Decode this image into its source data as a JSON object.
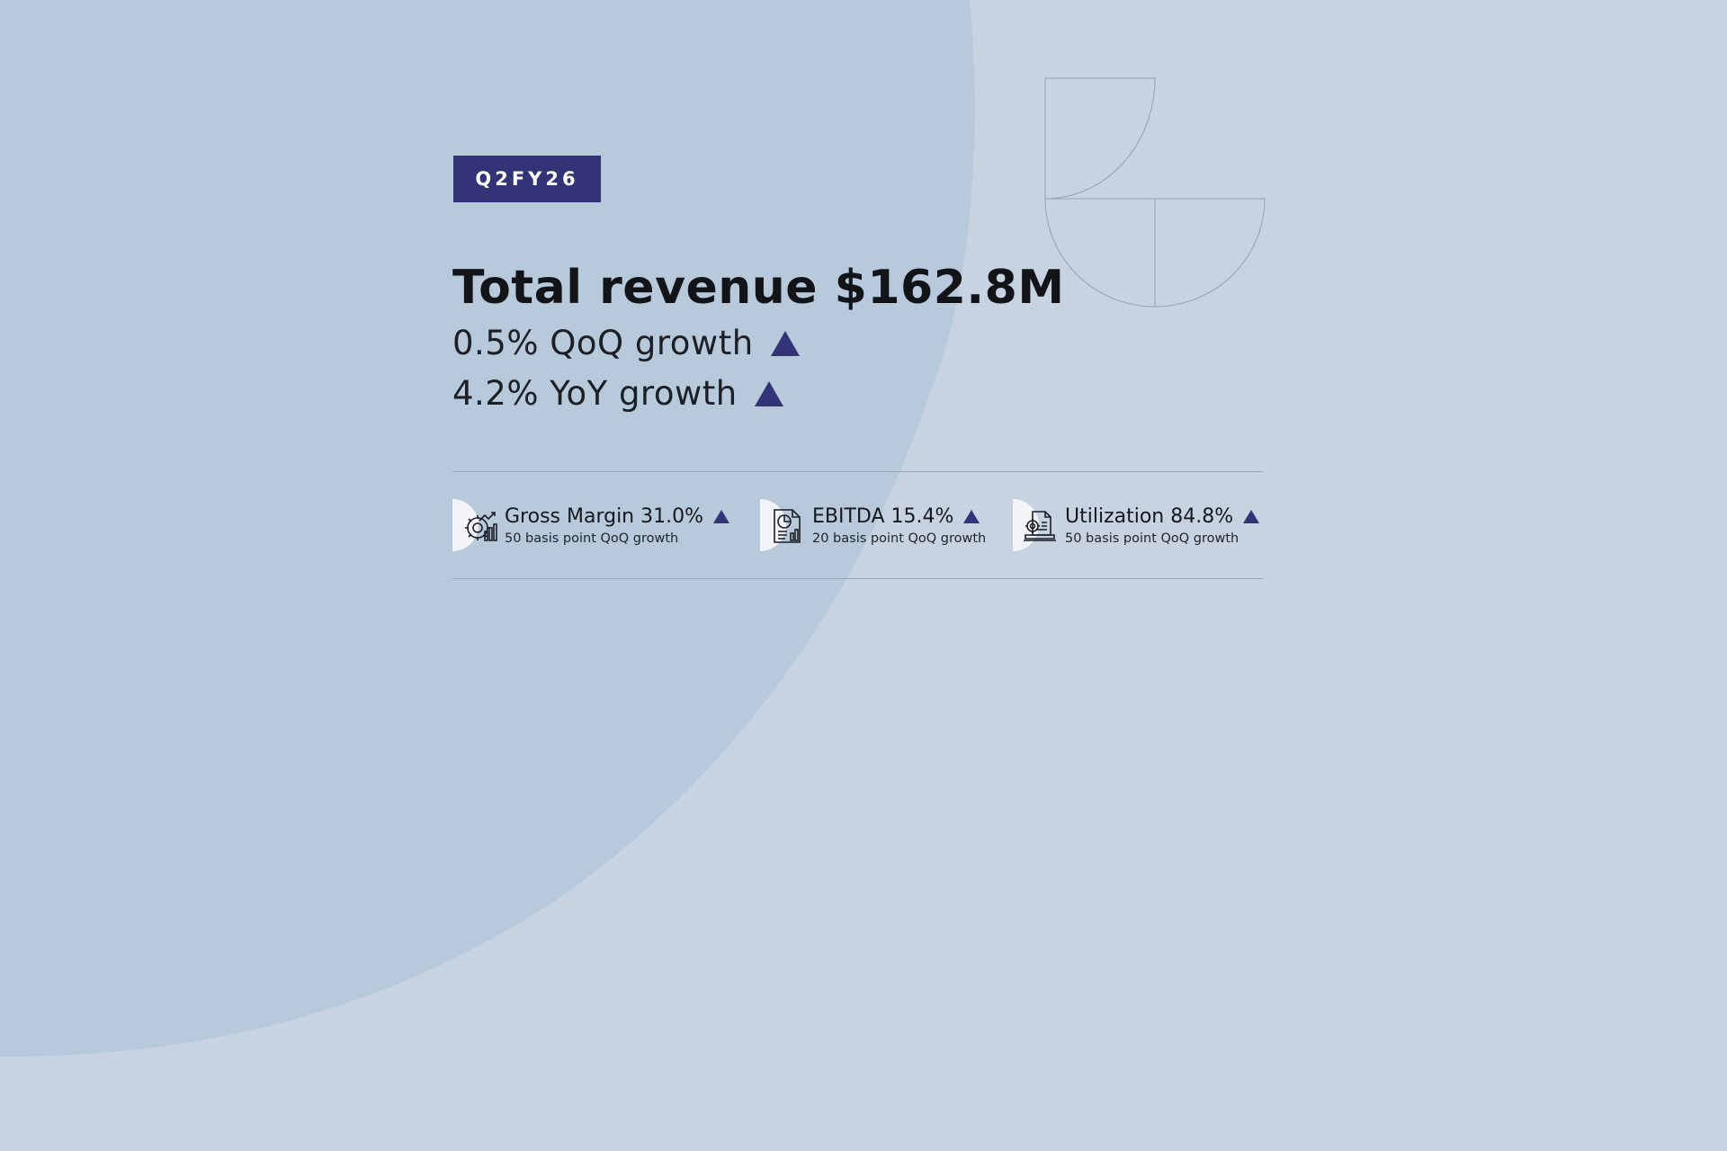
{
  "period_badge": "Q2FY26",
  "headline": "Total revenue $162.8M",
  "growth_rows": [
    "0.5% QoQ growth",
    "4.2% YoY growth"
  ],
  "kpis": [
    {
      "title": "Gross Margin 31.0%",
      "subtitle": "50 basis point QoQ growth",
      "icon": "gear-chart-icon"
    },
    {
      "title": "EBITDA 15.4%",
      "subtitle": "20 basis point QoQ growth",
      "icon": "report-chart-icon"
    },
    {
      "title": "Utilization 84.8%",
      "subtitle": "50 basis point QoQ growth",
      "icon": "laptop-gear-icon"
    }
  ],
  "colors": {
    "background": "#c7d3e0",
    "circle": "#b7c9db",
    "accent": "#333478",
    "text": "#121418"
  }
}
